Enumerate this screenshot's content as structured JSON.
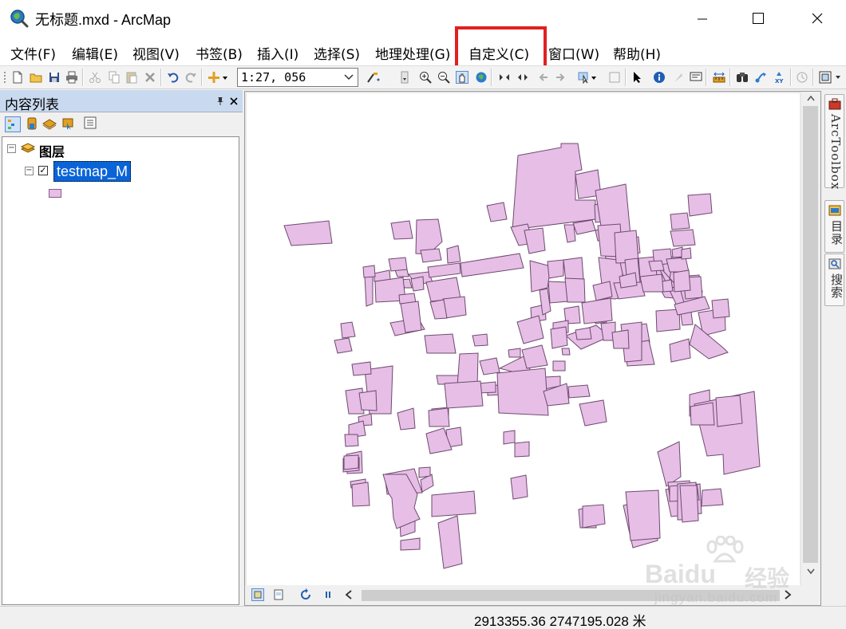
{
  "window": {
    "title": "无标题.mxd - ArcMap"
  },
  "menu": {
    "items": [
      {
        "label": "文件(F)"
      },
      {
        "label": "编辑(E)"
      },
      {
        "label": "视图(V)"
      },
      {
        "label": "书签(B)"
      },
      {
        "label": "插入(I)"
      },
      {
        "label": "选择(S)"
      },
      {
        "label": "地理处理(G)"
      },
      {
        "label": "自定义(C)"
      },
      {
        "label": "窗口(W)"
      },
      {
        "label": "帮助(H)"
      }
    ],
    "highlighted": "自定义(C)"
  },
  "toolbar": {
    "scale_value": "1:27, 056"
  },
  "toc": {
    "title": "内容列表",
    "root_label": "图层",
    "layer_name": "testmap_M",
    "layer_checked": true
  },
  "dock": {
    "tabs": [
      {
        "label": "ArcToolbox"
      },
      {
        "label": "目录"
      },
      {
        "label": "搜索"
      }
    ]
  },
  "status": {
    "coordinates": "2913355.36  2747195.028 米"
  },
  "watermark": {
    "brand": "Baidu",
    "line1": "经验",
    "line2": "jingyan.baidu.com"
  },
  "colors": {
    "polygon_fill": "#e6bee6",
    "polygon_stroke": "#6e4a6e",
    "highlight": "#e02020",
    "selection": "#0a64d8"
  }
}
